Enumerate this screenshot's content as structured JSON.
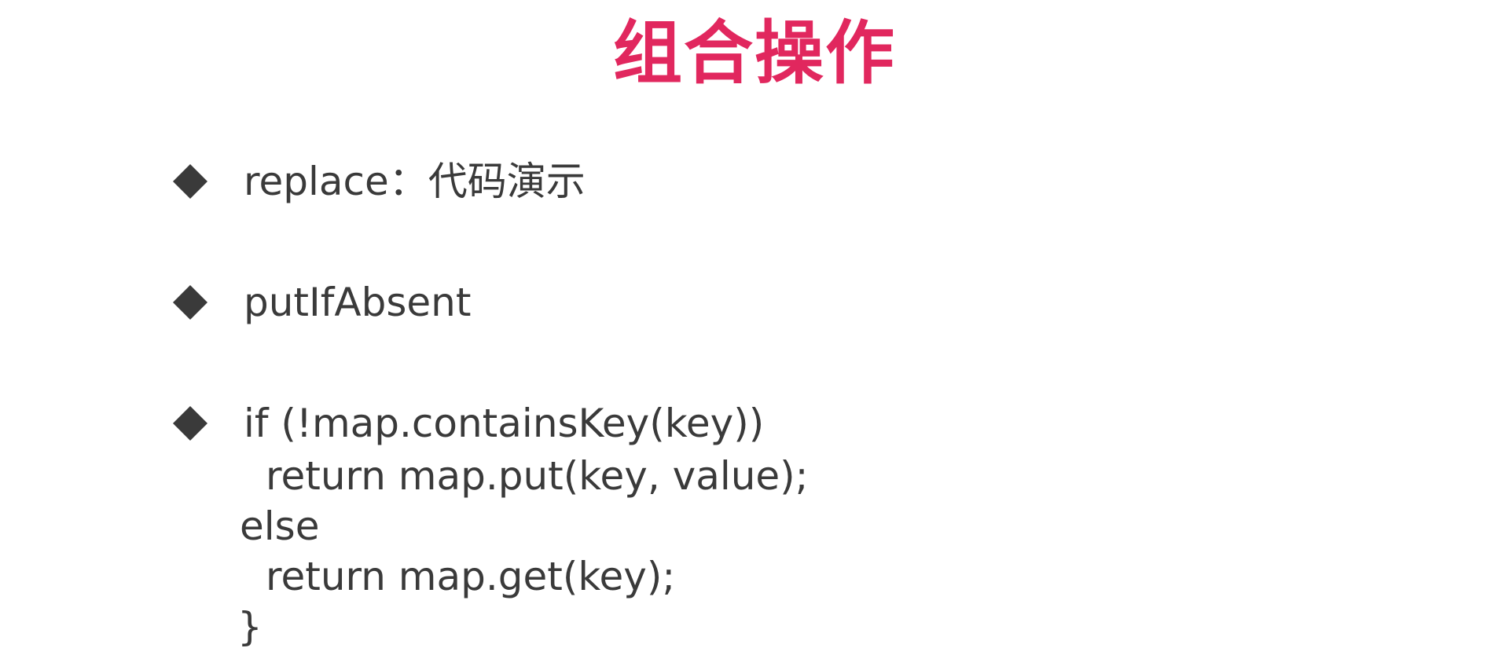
{
  "slide": {
    "title": "组合操作",
    "accent_color": "#e1275e",
    "text_color": "#3a3a3a",
    "bullet_icon": "black-diamond",
    "bullets": [
      {
        "text": "replace：代码演示"
      },
      {
        "text": "putIfAbsent"
      },
      {
        "text": "if (!map.containsKey(key))"
      }
    ],
    "code_lines": [
      "return map.put(key, value);",
      "else",
      "return map.get(key);",
      "}"
    ]
  }
}
